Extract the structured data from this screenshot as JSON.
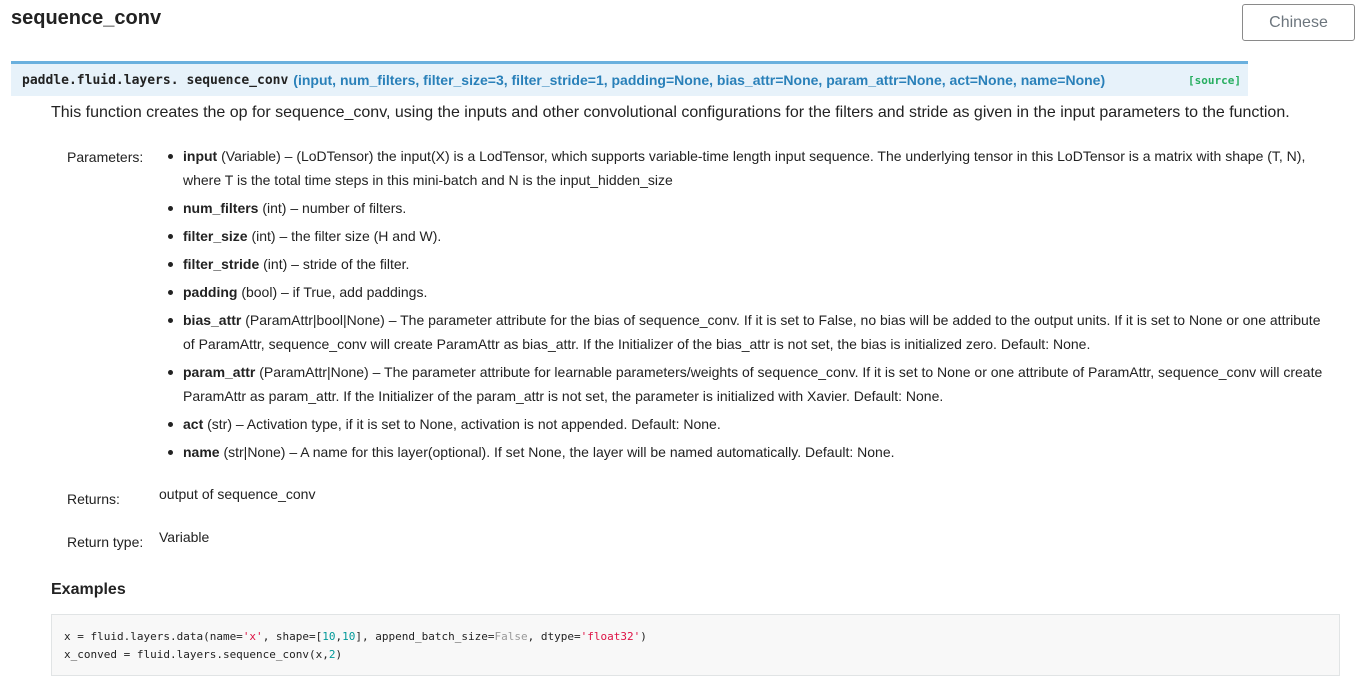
{
  "page": {
    "title": "sequence_conv",
    "language_button": "Chinese"
  },
  "signature": {
    "prefix": "paddle.fluid.layers.",
    "name": "sequence_conv",
    "params": "(input, num_filters, filter_size=3, filter_stride=1, padding=None, bias_attr=None, param_attr=None, act=None, name=None)",
    "source_link": "[source]"
  },
  "description": "This function creates the op for sequence_conv, using the inputs and other convolutional configurations for the filters and stride as given in the input parameters to the function.",
  "fields": {
    "parameters_label": "Parameters:",
    "returns_label": "Returns:",
    "returns_value": "output of sequence_conv",
    "return_type_label": "Return type:",
    "return_type_value": "Variable"
  },
  "parameters": [
    {
      "name": "input",
      "rest": " (Variable) – (LoDTensor) the input(X) is a LodTensor, which supports variable-time length input sequence. The underlying tensor in this LoDTensor is a matrix with shape (T, N), where T is the total time steps in this mini-batch and N is the input_hidden_size"
    },
    {
      "name": "num_filters",
      "rest": " (int) – number of filters."
    },
    {
      "name": "filter_size",
      "rest": " (int) – the filter size (H and W)."
    },
    {
      "name": "filter_stride",
      "rest": " (int) – stride of the filter."
    },
    {
      "name": "padding",
      "rest": " (bool) – if True, add paddings."
    },
    {
      "name": "bias_attr",
      "rest": " (ParamAttr|bool|None) – The parameter attribute for the bias of sequence_conv. If it is set to False, no bias will be added to the output units. If it is set to None or one attribute of ParamAttr, sequence_conv will create ParamAttr as bias_attr. If the Initializer of the bias_attr is not set, the bias is initialized zero. Default: None."
    },
    {
      "name": "param_attr",
      "rest": " (ParamAttr|None) – The parameter attribute for learnable parameters/weights of sequence_conv. If it is set to None or one attribute of ParamAttr, sequence_conv will create ParamAttr as param_attr. If the Initializer of the param_attr is not set, the parameter is initialized with Xavier. Default: None."
    },
    {
      "name": "act",
      "rest": " (str) – Activation type, if it is set to None, activation is not appended. Default: None."
    },
    {
      "name": "name",
      "rest": " (str|None) – A name for this layer(optional). If set None, the layer will be named automatically. Default: None."
    }
  ],
  "examples": {
    "heading": "Examples",
    "code": {
      "l1_a": "x = fluid.layers.data(name=",
      "l1_b": "'x'",
      "l1_c": ", shape=[",
      "l1_d": "10",
      "l1_e": ",",
      "l1_f": "10",
      "l1_g": "], append_batch_size=",
      "l1_h": "False",
      "l1_i": ", dtype=",
      "l1_j": "'float32'",
      "l1_k": ")",
      "l2_a": "x_conved = fluid.layers.sequence_conv(x,",
      "l2_b": "2",
      "l2_c": ")"
    }
  },
  "colors": {
    "signature_bg": "#e7f2fa",
    "signature_border": "#6ab0de",
    "signature_params": "#2980b9",
    "source_link": "#27ae60",
    "code_string": "#dd1144",
    "code_number": "#009999",
    "code_keyword": "#999999"
  }
}
